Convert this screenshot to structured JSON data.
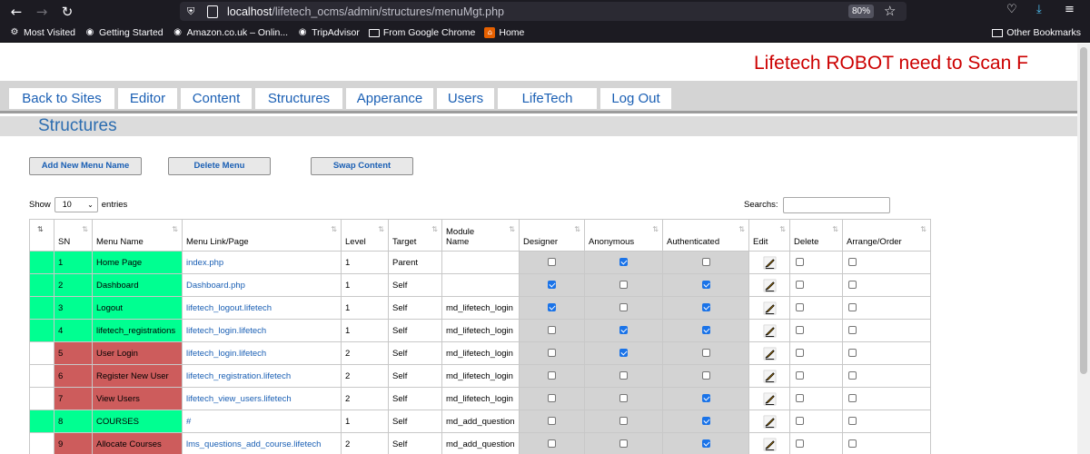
{
  "browser": {
    "url_host": "localhost",
    "url_path": "/lifetech_ocms/admin/structures/menuMgt.php",
    "zoom": "80%",
    "bookmarks": [
      {
        "label": "Most Visited",
        "icon": "gear-icon"
      },
      {
        "label": "Getting Started",
        "icon": "globe-icon"
      },
      {
        "label": "Amazon.co.uk – Onlin...",
        "icon": "globe-icon"
      },
      {
        "label": "TripAdvisor",
        "icon": "globe-icon"
      },
      {
        "label": "From Google Chrome",
        "icon": "folder-icon"
      },
      {
        "label": "Home",
        "icon": "home-icon"
      }
    ],
    "other_bookmarks": "Other Bookmarks"
  },
  "banner": "Lifetech ROBOT need to Scan F",
  "menu": [
    "Back to Sites",
    "Editor",
    "Content",
    "Structures",
    "Apperance",
    "Users",
    "LifeTech",
    "Log Out"
  ],
  "page_title": "Structures",
  "buttons": {
    "add": "Add New Menu Name",
    "delete": "Delete Menu",
    "swap": "Swap Content"
  },
  "controls": {
    "show_label": "Show",
    "show_value": "10",
    "entries_label": "entries",
    "search_label": "Searchs:"
  },
  "table": {
    "headers": [
      "SN",
      "Menu Name",
      "Menu Link/Page",
      "Level",
      "Target",
      "Module Name",
      "Designer",
      "Anonymous",
      "Authenticated",
      "Edit",
      "Delete",
      "Arrange/Order"
    ],
    "rows": [
      {
        "color": "green",
        "sn": "1",
        "name": "Home Page",
        "link": "index.php",
        "level": "1",
        "target": "Parent",
        "module": "",
        "designer": false,
        "anonymous": true,
        "authenticated": false
      },
      {
        "color": "green",
        "sn": "2",
        "name": "Dashboard",
        "link": "Dashboard.php",
        "level": "1",
        "target": "Self",
        "module": "",
        "designer": true,
        "anonymous": false,
        "authenticated": true
      },
      {
        "color": "green",
        "sn": "3",
        "name": "Logout",
        "link": "lifetech_logout.lifetech",
        "level": "1",
        "target": "Self",
        "module": "md_lifetech_login",
        "designer": true,
        "anonymous": false,
        "authenticated": true
      },
      {
        "color": "green",
        "sn": "4",
        "name": "lifetech_registrations",
        "link": "lifetech_login.lifetech",
        "level": "1",
        "target": "Self",
        "module": "md_lifetech_login",
        "designer": false,
        "anonymous": true,
        "authenticated": true
      },
      {
        "color": "red",
        "sn": "5",
        "name": "User Login",
        "link": "lifetech_login.lifetech",
        "level": "2",
        "target": "Self",
        "module": "md_lifetech_login",
        "designer": false,
        "anonymous": true,
        "authenticated": false
      },
      {
        "color": "red",
        "sn": "6",
        "name": "Register New User",
        "link": "lifetech_registration.lifetech",
        "level": "2",
        "target": "Self",
        "module": "md_lifetech_login",
        "designer": false,
        "anonymous": false,
        "authenticated": false
      },
      {
        "color": "red",
        "sn": "7",
        "name": "View Users",
        "link": "lifetech_view_users.lifetech",
        "level": "2",
        "target": "Self",
        "module": "md_lifetech_login",
        "designer": false,
        "anonymous": false,
        "authenticated": true
      },
      {
        "color": "green",
        "sn": "8",
        "name": "COURSES",
        "link": "#",
        "level": "1",
        "target": "Self",
        "module": "md_add_question",
        "designer": false,
        "anonymous": false,
        "authenticated": true
      },
      {
        "color": "red",
        "sn": "9",
        "name": "Allocate Courses",
        "link": "lms_questions_add_course.lifetech",
        "level": "2",
        "target": "Self",
        "module": "md_add_question",
        "designer": false,
        "anonymous": false,
        "authenticated": true
      }
    ]
  }
}
